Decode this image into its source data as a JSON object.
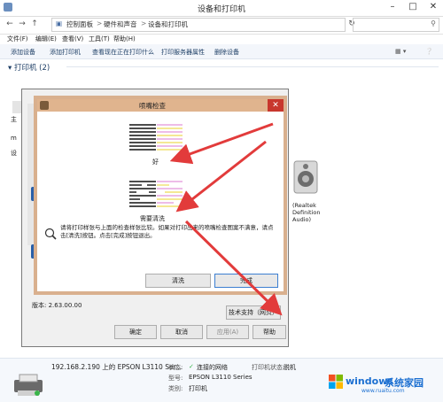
{
  "window": {
    "title": "设备和打印机"
  },
  "address": {
    "crumbs": [
      "控制面板",
      "硬件和声音",
      "设备和打印机"
    ],
    "separators": [
      ">",
      ">"
    ]
  },
  "menu": [
    "文件(F)",
    "编辑(E)",
    "查看(V)",
    "工具(T)",
    "帮助(H)"
  ],
  "commands": [
    "添加设备",
    "添加打印机",
    "查看现在正在打印什么",
    "打印服务器属性",
    "删除设备"
  ],
  "section": {
    "label": "打印机 (2)"
  },
  "left_labels": [
    "主",
    "m",
    "设"
  ],
  "right_device": {
    "label": "(Realtek\nDefinition\nAudio)"
  },
  "properties": {
    "version": "版本: 2.63.00.00",
    "tech_support": "技术支持（网页）",
    "buttons": [
      "确定",
      "取消",
      "应用(A)",
      "帮助"
    ]
  },
  "nozzle": {
    "title": "喷嘴检查",
    "good_label": "好",
    "bad_label": "需要清洗",
    "message": "请将打印样张与上面的检查样张比较。如果对打印出来的喷嘴检查图案不满意，请点击[清洗]按钮。点击[完成]按钮退出。",
    "clean_button": "清洗",
    "finish_button": "完成"
  },
  "details": {
    "name": "192.168.2.190 上的 EPSON L3110 Ser...",
    "status_label": "状态:",
    "status_value": "连接的网络",
    "model_label": "型号:",
    "model_value": "EPSON L3110 Series",
    "category_label": "类别:",
    "category_value": "打印机",
    "printer_status_label": "打印机状态:",
    "printer_status_value": "脱机"
  },
  "watermark": {
    "brand_a": "windows",
    "brand_b": "系统家园",
    "url": "www.ruaitu.com"
  },
  "colors": {
    "dialog_border": "#d9b08e",
    "dialog_title": "#e0b48e",
    "close_red": "#c8372d",
    "arrow_red": "#e23b3b",
    "link_blue": "#1e3f66"
  }
}
